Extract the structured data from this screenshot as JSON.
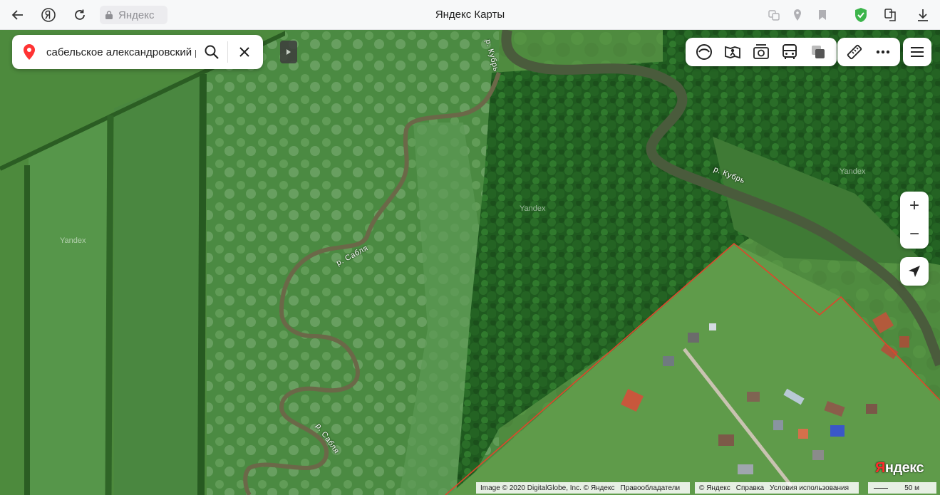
{
  "browser": {
    "address": "Яндекс",
    "title": "Яндекс Карты"
  },
  "search": {
    "value": "сабельское александровский р"
  },
  "map": {
    "labels": {
      "river_sablya_1": "р. Сабля",
      "river_sablya_2": "р. Сабля",
      "river_kubr_1": "р. Кубрь",
      "river_kubr_2": "р. Кубрь"
    },
    "watermarks": [
      "Yandex",
      "Yandex",
      "Yandex"
    ]
  },
  "controls": {
    "zoom_in": "+",
    "zoom_out": "−"
  },
  "attribution": {
    "imagery": "Image © 2020 DigitalGlobe, Inc. © Яндекс",
    "rights_holders": "Правообладатели",
    "copyright": "© Яндекс",
    "help": "Справка",
    "terms": "Условия использования",
    "logo_first": "Я",
    "logo_rest": "ндекс",
    "scale": "50 м"
  },
  "icons": {
    "back": "arrow-left-icon",
    "yandex": "yandex-browser-icon",
    "reload": "reload-icon",
    "lock": "lock-icon",
    "pin": "location-pin-icon",
    "search": "search-icon",
    "close": "close-icon",
    "layers": "layers-icon",
    "panorama": "panorama-icon",
    "photo": "camera-icon",
    "transport": "bus-icon",
    "traffic": "traffic-icon",
    "ruler": "ruler-icon",
    "more": "more-icon",
    "menu": "menu-icon",
    "geolocation": "geolocation-icon"
  },
  "colors": {
    "pin": "#ff3333",
    "boundary": "#e0452b",
    "shield": "#3cb44b"
  }
}
